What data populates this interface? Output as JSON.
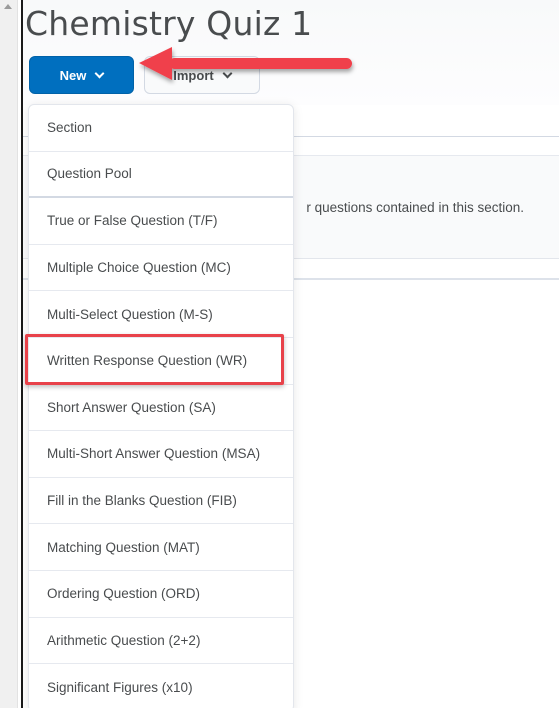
{
  "page": {
    "title": "Chemistry Quiz 1"
  },
  "toolbar": {
    "new_label": "New",
    "new_icon": "chevron-down-icon",
    "import_label": "Import",
    "import_icon": "chevron-down-icon"
  },
  "section_panel": {
    "text": "r questions contained in this section."
  },
  "new_menu": {
    "items": [
      {
        "label": "Section"
      },
      {
        "label": "Question Pool"
      },
      {
        "label": "True or False Question (T/F)"
      },
      {
        "label": "Multiple Choice Question (MC)"
      },
      {
        "label": "Multi-Select Question (M-S)"
      },
      {
        "label": "Written Response Question (WR)",
        "highlighted": true
      },
      {
        "label": "Short Answer Question (SA)"
      },
      {
        "label": "Multi-Short Answer Question (MSA)"
      },
      {
        "label": "Fill in the Blanks Question (FIB)"
      },
      {
        "label": "Matching Question (MAT)"
      },
      {
        "label": "Ordering Question (ORD)"
      },
      {
        "label": "Arithmetic Question (2+2)"
      },
      {
        "label": "Significant Figures (x10)"
      }
    ]
  },
  "annotations": {
    "arrow_color": "#f0414b",
    "highlight_color": "#e8424a",
    "arrow_target": "New button",
    "highlighted_item": "Written Response Question (WR)"
  },
  "colors": {
    "primary_button": "#006fbf",
    "text": "#494c4e"
  }
}
